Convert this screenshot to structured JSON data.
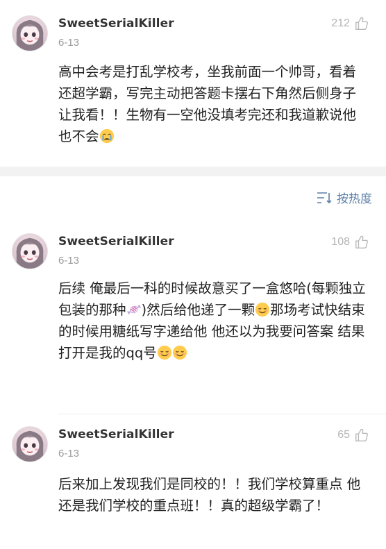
{
  "sort": {
    "label": "按热度",
    "icon": "sort-lines-icon"
  },
  "comments": [
    {
      "username": "SweetSerialKiller",
      "date": "6-13",
      "likes": "212",
      "text": "高中会考是打乱学校考，坐我前面一个帅哥，看着还超学霸，写完主动把答题卡摆右下角然后侧身子让我看！！生物有一空他没填考完还和我道歉说他也不会",
      "emojis": [
        "crying-face"
      ]
    },
    {
      "username": "SweetSerialKiller",
      "date": "6-13",
      "likes": "108",
      "text_parts": [
        "后续 俺最后一科的时候故意买了一盒悠哈(每颗独立包装的那种",
        ")然后给他递了一颗",
        "那场考试快结束的时候用糖纸写字递给他 他还以为我要问答案 结果打开是我的qq号"
      ],
      "emojis": [
        "candy",
        "smiling-face",
        "smiling-face",
        "smiling-face"
      ]
    },
    {
      "username": "SweetSerialKiller",
      "date": "6-13",
      "likes": "65",
      "text": "后来加上发现我们是同校的！！我们学校算重点 他还是我们学校的重点班！！真的超级学霸了！"
    }
  ],
  "colors": {
    "link": "#5b7fa8",
    "meta": "#999999",
    "likes": "#b4b4b4",
    "divider": "#f2f2f2"
  }
}
